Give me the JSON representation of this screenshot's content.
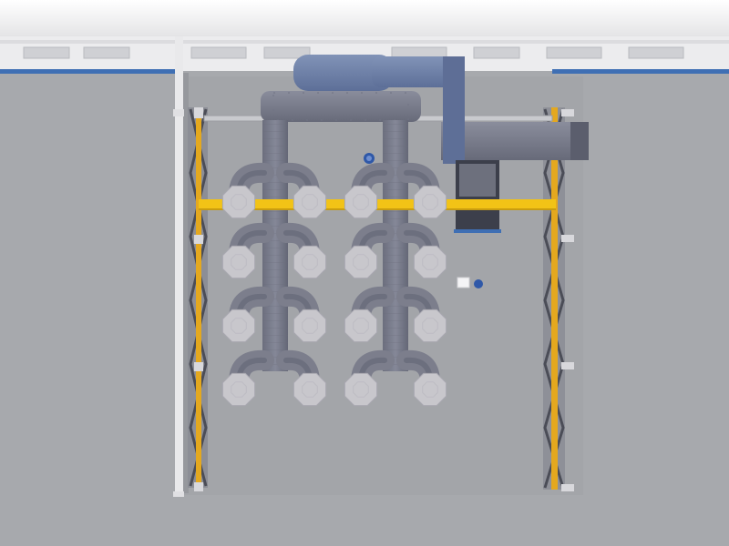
{
  "scene": {
    "view": "top-down",
    "subject": "industrial-ventilation-system",
    "colors": {
      "floor": "#a7a9ad",
      "floor_inner": "#a3a5a9",
      "wall": "#e6e6e8",
      "blue_band": "#3f6fb4",
      "duct": "#7c7e8c",
      "duct_dark": "#5c5f6f",
      "duct_blue": "#6f82a8",
      "hood": "#c8c7cc",
      "hood_edge": "#a9a8b1",
      "yellow_beam": "#f2c316",
      "column_yellow": "#e4a81f",
      "truss": "#4b4d57"
    },
    "hood_grid": {
      "rows": 4,
      "columns": 4
    },
    "icons": [
      "fan-icon",
      "box-icon",
      "valve-icon"
    ]
  }
}
